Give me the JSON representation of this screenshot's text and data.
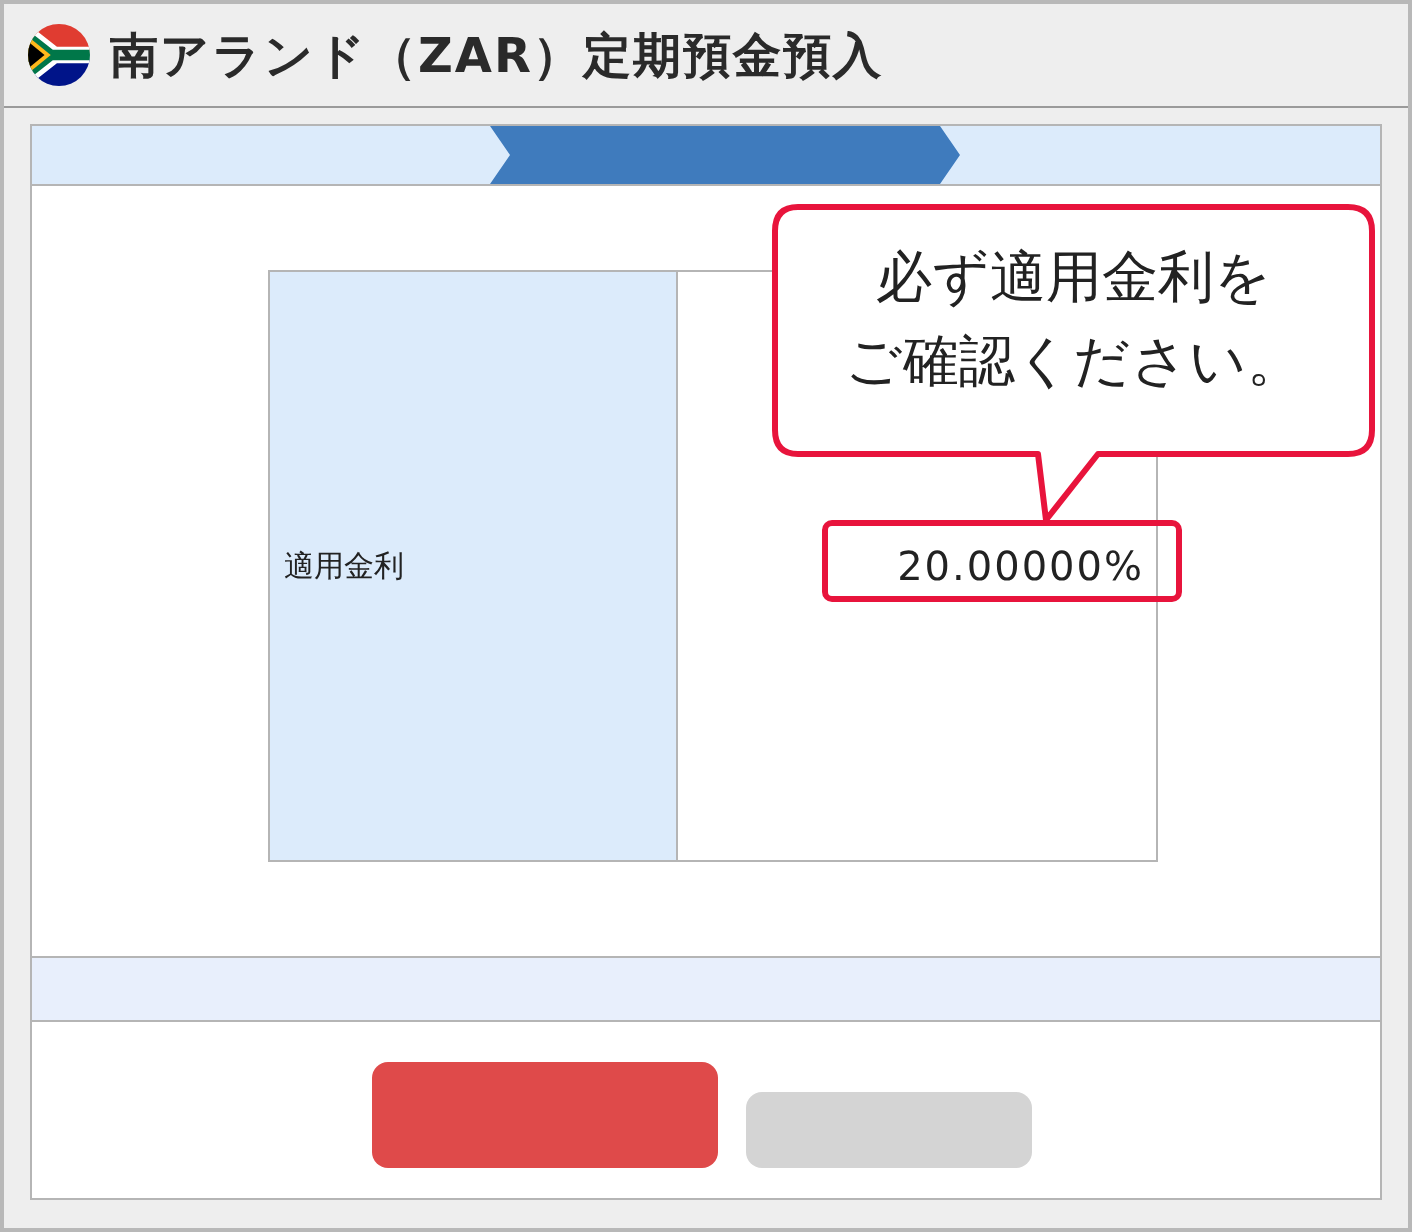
{
  "header": {
    "title": "南アランド（ZAR）定期預金預入"
  },
  "steps": [
    {
      "selected": false
    },
    {
      "selected": true
    },
    {
      "selected": false
    }
  ],
  "table": {
    "rows": [
      {
        "label": "適用金利",
        "value": "20.00000%"
      }
    ]
  },
  "callout": {
    "lines": [
      "必ず適用金利を",
      "ご確認ください。"
    ]
  },
  "buttons": [
    {
      "kind": "primary"
    },
    {
      "kind": "secondary"
    }
  ]
}
